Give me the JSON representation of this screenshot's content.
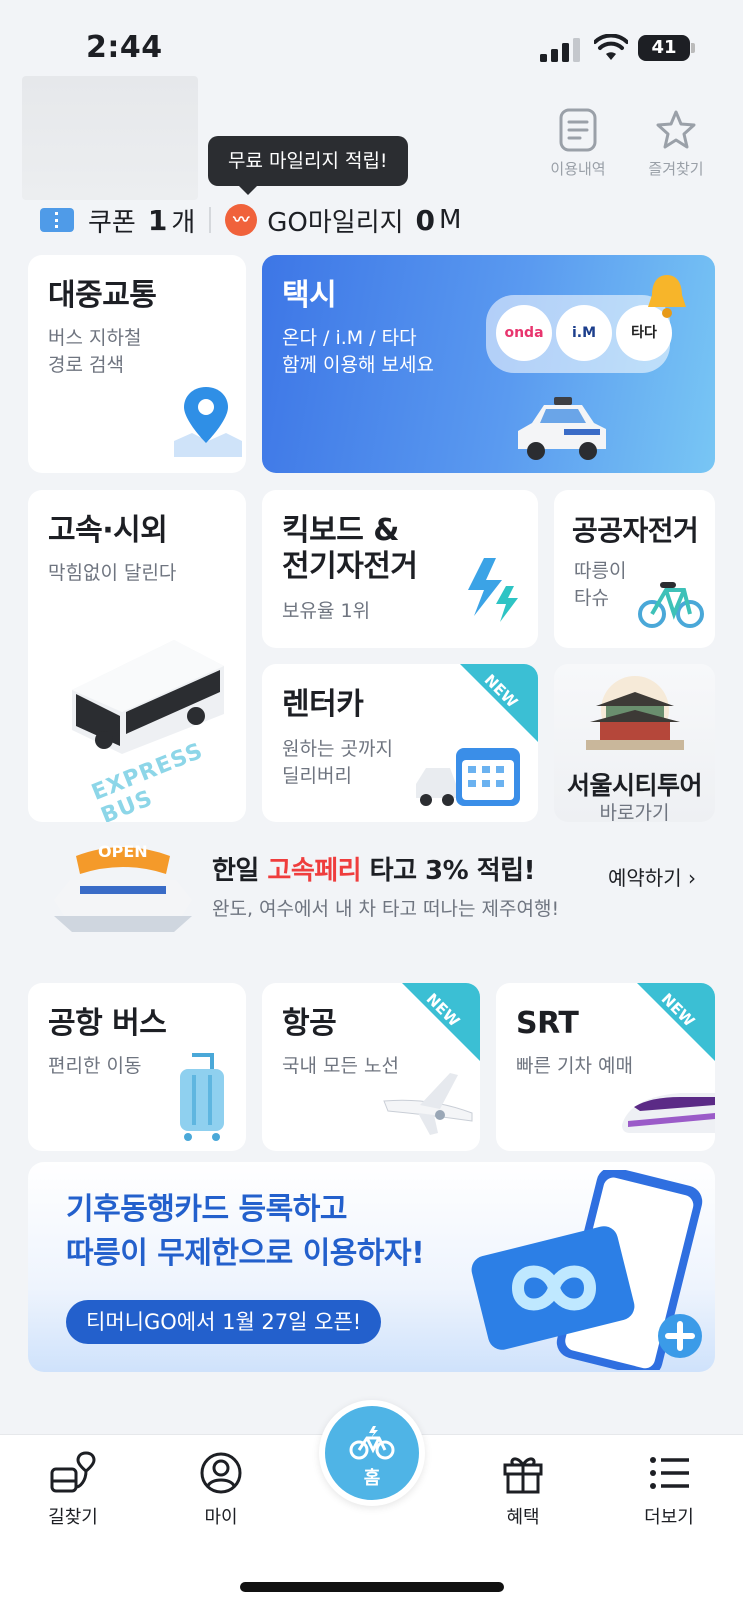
{
  "status": {
    "time": "2:44",
    "battery": "41"
  },
  "top_actions": {
    "history_label": "이용내역",
    "favorites_label": "즐겨찾기"
  },
  "tooltip": "무료 마일리지 적립!",
  "summary": {
    "coupon_label": "쿠폰",
    "coupon_count": "1",
    "coupon_unit": "개",
    "mileage_label": "GO마일리지",
    "mileage_value": "0",
    "mileage_unit": "M"
  },
  "services": {
    "transit": {
      "title": "대중교통",
      "sub1": "버스 지하철",
      "sub2": "경로 검색"
    },
    "taxi": {
      "title": "택시",
      "sub1": "온다 / i.M / 타다",
      "sub2": "함께 이용해 보세요",
      "brands": [
        "onda",
        "i.M",
        "타다"
      ]
    },
    "express": {
      "title": "고속·시외",
      "sub": "막힘없이 달린다",
      "art_text": "EXPRESS BUS"
    },
    "kickboard": {
      "title1": "킥보드 &",
      "title2": "전기자전거",
      "sub": "보유율 1위"
    },
    "bike": {
      "title": "공공자전거",
      "sub1": "따릉이",
      "sub2": "타슈"
    },
    "rentcar": {
      "title": "렌터카",
      "sub1": "원하는 곳까지",
      "sub2": "딜리버리",
      "badge": "NEW"
    },
    "citytour": {
      "title": "서울시티투어",
      "sub": "바로가기"
    }
  },
  "ferry_banner": {
    "title_pre": "한일 ",
    "title_red": "고속페리",
    "title_post": " 타고 3% 적립!",
    "sub": "완도, 여수에서 내 차 타고 떠나는 제주여행!",
    "cta": "예약하기",
    "art_text": "OPEN"
  },
  "services2": {
    "airport_bus": {
      "title": "공항 버스",
      "sub": "편리한 이동"
    },
    "flight": {
      "title": "항공",
      "sub": "국내 모든 노선",
      "badge": "NEW"
    },
    "srt": {
      "title": "SRT",
      "sub": "빠른 기차 예매",
      "badge": "NEW"
    }
  },
  "promo": {
    "line1": "기후동행카드 등록하고",
    "line2": "따릉이 무제한으로 이용하자!",
    "pill": "티머니GO에서 1월 27일 오픈!"
  },
  "tabs": {
    "route": "길찾기",
    "my": "마이",
    "home": "홈",
    "benefits": "혜택",
    "more": "더보기"
  },
  "colors": {
    "accent_blue": "#2360cc",
    "teal": "#3bbfd4",
    "home_button": "#4fb4e6",
    "ferry_red": "#ef3d3d"
  }
}
